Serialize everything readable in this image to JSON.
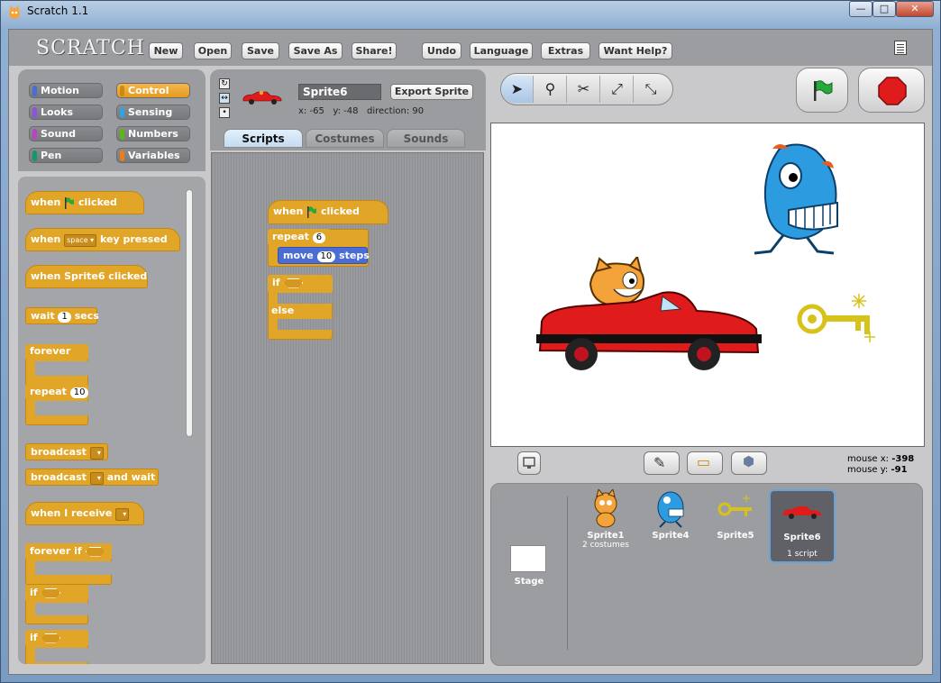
{
  "window": {
    "title": "Scratch 1.1",
    "buttons": {
      "minimize": "—",
      "maximize": "□",
      "close": "✕"
    }
  },
  "app": {
    "logo": "SCRATCH",
    "toolbar_buttons": [
      "New",
      "Open",
      "Save",
      "Save As",
      "Share!",
      "Undo",
      "Language",
      "Extras",
      "Want Help?"
    ]
  },
  "categories": [
    {
      "label": "Motion",
      "color": "#4a6cd4"
    },
    {
      "label": "Control",
      "color": "#e1a627"
    },
    {
      "label": "Looks",
      "color": "#8a55d7"
    },
    {
      "label": "Sensing",
      "color": "#2ca5e2"
    },
    {
      "label": "Sound",
      "color": "#bb42c3"
    },
    {
      "label": "Numbers",
      "color": "#5cb712"
    },
    {
      "label": "Pen",
      "color": "#0e9a6c"
    },
    {
      "label": "Variables",
      "color": "#ee7d16"
    }
  ],
  "palette": {
    "when_flag_when": "when",
    "when_flag_clicked": "clicked",
    "when_key_when": "when",
    "when_key_key": "space",
    "when_key_pressed": "key pressed",
    "when_sprite_clicked": "when Sprite6 clicked",
    "wait": "wait",
    "wait_value": "1",
    "wait_secs": "secs",
    "forever": "forever",
    "repeat": "repeat",
    "repeat_value": "10",
    "broadcast": "broadcast",
    "broadcast_and": "broadcast",
    "and_wait": "and wait",
    "when_receive": "when I receive",
    "forever_if": "forever if",
    "if1": "if",
    "if2": "if"
  },
  "sprite_info": {
    "name": "Sprite6",
    "export": "Export Sprite",
    "x_label": "x:",
    "x": "-65",
    "y_label": "y:",
    "y": "-48",
    "direction_label": "direction:",
    "direction": "90"
  },
  "tabs": [
    "Scripts",
    "Costumes",
    "Sounds"
  ],
  "script": {
    "when": "when",
    "clicked": "clicked",
    "repeat": "repeat",
    "repeat_value": "6",
    "move": "move",
    "move_value": "10",
    "steps": "steps",
    "if": "if",
    "else": "else"
  },
  "stage_tools": [
    "arrow-icon",
    "stamp-icon",
    "scissors-icon",
    "grow-icon",
    "shrink-icon"
  ],
  "mouse": {
    "x_label": "mouse x:",
    "x": "-398",
    "y_label": "mouse y:",
    "y": "-91"
  },
  "sprites": {
    "stage_label": "Stage",
    "items": [
      {
        "name": "Sprite1",
        "detail": "2 costumes"
      },
      {
        "name": "Sprite4",
        "detail": ""
      },
      {
        "name": "Sprite5",
        "detail": ""
      },
      {
        "name": "Sprite6",
        "detail": "1 script"
      }
    ]
  },
  "colors": {
    "control": "#e1a627",
    "motion": "#4a6cd4",
    "selection": "#6aa2da",
    "stop": "#e01b1b",
    "flag": "#27a93b"
  }
}
